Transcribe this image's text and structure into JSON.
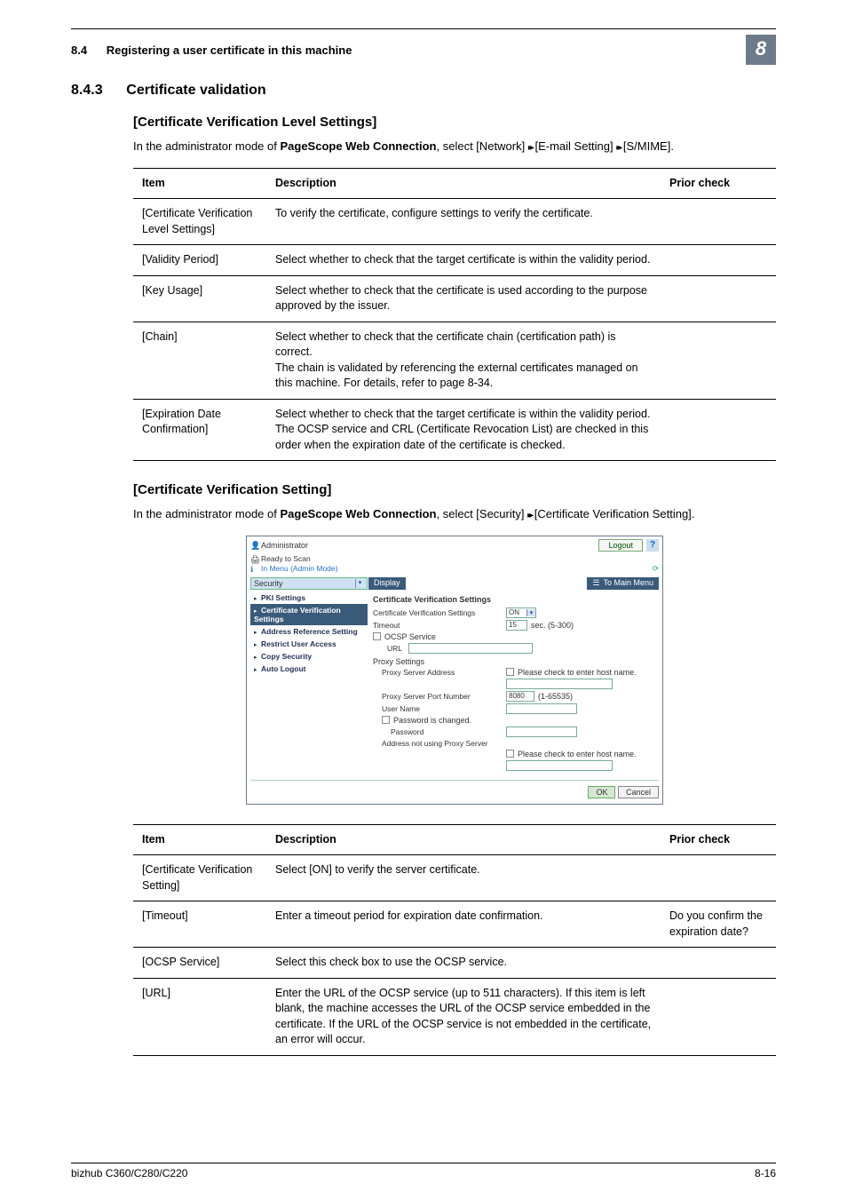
{
  "header": {
    "section_no": "8.4",
    "section_title": "Registering a user certificate in this machine",
    "chapter_badge": "8"
  },
  "s1": {
    "number": "8.4.3",
    "title": "Certificate validation",
    "sub1": {
      "heading": "[Certificate Verification Level Settings]",
      "intro_pre": "In the administrator mode of ",
      "intro_bold": "PageScope Web Connection",
      "intro_post1": ", select [Network] ",
      "intro_post2": " [E-mail Setting] ",
      "intro_post3": " [S/MIME].",
      "th_item": "Item",
      "th_desc": "Description",
      "th_prior": "Prior check",
      "rows": [
        {
          "item": "[Certificate Verification Level Settings]",
          "desc": "To verify the certificate, configure settings to verify the certificate.",
          "prior": ""
        },
        {
          "item": "[Validity Period]",
          "desc": "Select whether to check that the target certificate is within the validity period.",
          "prior": ""
        },
        {
          "item": "[Key Usage]",
          "desc": "Select whether to check that the certificate is used according to the purpose approved by the issuer.",
          "prior": ""
        },
        {
          "item": "[Chain]",
          "desc": "Select whether to check that the certificate chain (certification path) is correct.\nThe chain is validated by referencing the external certificates managed on this machine. For details, refer to page 8-34.",
          "prior": ""
        },
        {
          "item": "[Expiration Date Confirmation]",
          "desc": "Select whether to check that the target certificate is within the validity period.\nThe OCSP service and CRL (Certificate Revocation List) are checked in this order when the expiration date of the certificate is checked.",
          "prior": ""
        }
      ]
    },
    "sub2": {
      "heading": "[Certificate Verification Setting]",
      "intro_pre": "In the administrator mode of ",
      "intro_bold": "PageScope Web Connection",
      "intro_post1": ", select [Security] ",
      "intro_post2": " [Certificate Verification Setting].",
      "th_item": "Item",
      "th_desc": "Description",
      "th_prior": "Prior check",
      "rows": [
        {
          "item": "[Certificate Verification Setting]",
          "desc": "Select [ON] to verify the server certificate.",
          "prior": ""
        },
        {
          "item": "[Timeout]",
          "desc": "Enter a timeout period for expiration date confirmation.",
          "prior": "Do you confirm the expiration date?"
        },
        {
          "item": "[OCSP Service]",
          "desc": "Select this check box to use the OCSP service.",
          "prior": ""
        },
        {
          "item": "[URL]",
          "desc": "Enter the URL of the OCSP service (up to 511 characters). If this item is left blank, the machine accesses the URL of the OCSP service embedded in the certificate. If the URL of the OCSP service is not embedded in the certificate, an error will occur.",
          "prior": ""
        }
      ]
    }
  },
  "screenshot": {
    "admin": "Administrator",
    "logout": "Logout",
    "ready": "Ready to Scan",
    "menu": "In Menu (Admin Mode)",
    "security": "Security",
    "display": "Display",
    "tomain": "To Main Menu",
    "side": [
      "PKI Settings",
      "Certificate Verification Settings",
      "Address Reference Setting",
      "Restrict User Access",
      "Copy Security",
      "Auto Logout"
    ],
    "main_title": "Certificate Verification Settings",
    "r_cvs": "Certificate Verification Settings",
    "r_on": "ON",
    "r_timeout": "Timeout",
    "r_timeout_val": "15",
    "r_timeout_unit": "sec. (5-300)",
    "r_ocsp": "OCSP Service",
    "r_url": "URL",
    "r_proxy": "Proxy Settings",
    "r_psa": "Proxy Server Address",
    "r_hostnote": "Please check to enter host name.",
    "r_port": "Proxy Server Port Number",
    "r_port_val": "8080",
    "r_port_range": "(1-65535)",
    "r_user": "User Name",
    "r_pwchg": "Password is changed.",
    "r_pw": "Password",
    "r_noproxy": "Address not using Proxy Server",
    "ok": "OK",
    "cancel": "Cancel"
  },
  "footer": {
    "left": "bizhub C360/C280/C220",
    "right": "8-16"
  }
}
